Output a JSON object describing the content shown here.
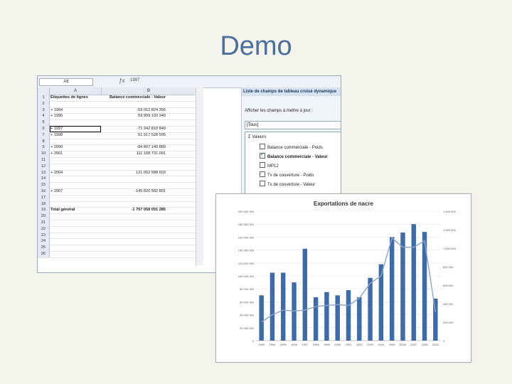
{
  "slide": {
    "title": "Demo"
  },
  "excel": {
    "name_box": "A6",
    "formula": "1997",
    "columns": [
      "A",
      "B"
    ],
    "headers": {
      "row_label": "Étiquettes de lignes",
      "value_label": "Balance commerciale - Valeur"
    },
    "rows": [
      {
        "n": "3",
        "year": "1994",
        "value": "-59 012 824 356"
      },
      {
        "n": "4",
        "year": "1995",
        "value": "59 909 193 340"
      },
      {
        "n": "6",
        "year": "1997",
        "value": "-71 342 818 840"
      },
      {
        "n": "7",
        "year": "1998",
        "value": "51 917 528 505"
      },
      {
        "n": "9",
        "year": "2000",
        "value": "-84 807 140 889"
      },
      {
        "n": "10",
        "year": "2001",
        "value": "111 168 731 091"
      },
      {
        "n": "13",
        "year": "2004",
        "value": "121 052 588 603"
      },
      {
        "n": "16",
        "year": "2007",
        "value": "-145 820 582 801"
      }
    ],
    "row_numbers": [
      "1",
      "2",
      "3",
      "4",
      "5",
      "6",
      "7",
      "8",
      "9",
      "10",
      "11",
      "12",
      "13",
      "14",
      "15",
      "16",
      "17",
      "18",
      "19",
      "20",
      "21",
      "22",
      "23",
      "24",
      "25",
      "26"
    ],
    "total": {
      "n": "19",
      "label": "Total général",
      "value": "-1 757 058 091 285"
    }
  },
  "panel": {
    "title": "Liste de champs de tableau croisé dynamique",
    "prompt": "Afficher les champs à mettre à jour :",
    "select": "[Tous]",
    "values_node": "Σ Valeurs",
    "fields": [
      {
        "label": "Balance commerciale - Poids",
        "checked": false,
        "bold": false
      },
      {
        "label": "Balance commerciale - Valeur",
        "checked": true,
        "bold": true
      },
      {
        "label": "MP12",
        "checked": false,
        "bold": false
      },
      {
        "label": "Tx de couverture - Poids",
        "checked": false,
        "bold": false
      },
      {
        "label": "Tx de couverture - Valeur",
        "checked": false,
        "bold": false
      }
    ]
  },
  "chart_data": {
    "type": "bar",
    "title": "Exportations de nacre",
    "categories": [
      "1993",
      "1994",
      "1995",
      "1996",
      "1997",
      "1998",
      "1999",
      "2000",
      "2001",
      "2002",
      "2003",
      "2004",
      "2005",
      "2006",
      "2007",
      "2008",
      "2009"
    ],
    "series": [
      {
        "values": [
          70000000,
          105000000,
          105000000,
          90000000,
          142000000,
          67000000,
          75000000,
          70000000,
          78000000,
          67000000,
          97000000,
          118000000,
          160000000,
          167000000,
          180000000,
          168000000,
          65000000
        ]
      },
      {
        "values": [
          200000,
          280000,
          330000,
          320000,
          330000,
          370000,
          380000,
          390000,
          380000,
          460000,
          620000,
          700000,
          1110000,
          1010000,
          1010000,
          1080000,
          310000
        ]
      }
    ],
    "y_left_ticks": [
      "0",
      "20 000 000",
      "40 000 000",
      "60 000 000",
      "80 000 000",
      "100 000 000",
      "120 000 000",
      "140 000 000",
      "160 000 000",
      "180 000 000",
      "200 000 000"
    ],
    "y_right_ticks": [
      "0",
      "200 000",
      "400 000",
      "600 000",
      "800 000",
      "1 000 000",
      "1 200 000",
      "1 400 000"
    ],
    "ylim_left": [
      0,
      200000000
    ],
    "ylim_right": [
      0,
      1400000
    ],
    "colors": {
      "bars": "#3d6aa8",
      "line": "#8ea4c8"
    }
  }
}
